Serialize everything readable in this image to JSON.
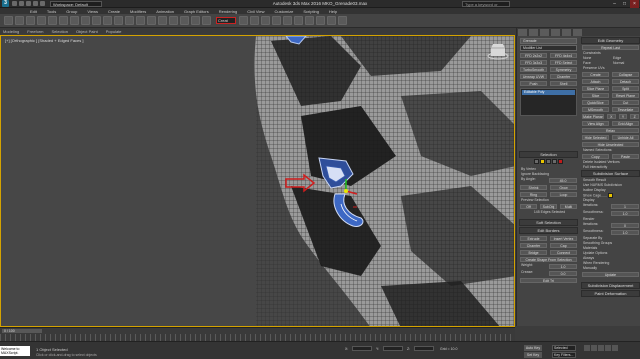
{
  "titlebar": {
    "workspace": "Workspace: Default",
    "title": "Autodesk 3ds Max 2016     MKO_Grenade03.max",
    "search_placeholder": "Type a keyword or phrase"
  },
  "menu": [
    "Edit",
    "Tools",
    "Group",
    "Views",
    "Create",
    "Modifiers",
    "Animation",
    "Graph Editors",
    "Rendering",
    "Civil View",
    "Customize",
    "Scripting",
    "Help"
  ],
  "toolbar": {
    "selection_set": "Creat"
  },
  "ribbon": [
    "Modeling",
    "Freeform",
    "Selection",
    "Object Paint",
    "Populate"
  ],
  "viewport": {
    "label": "[+] [Orthographic ] [Shaded + Edged Faces ]"
  },
  "panel": {
    "left": {
      "object_name": "Grenade",
      "modifier_list": "Modifier List",
      "buttons": [
        [
          "FFD 2x2x2",
          "FFD 4x4x4"
        ],
        [
          "FFD 3x3x3",
          "FFD Select"
        ],
        [
          "TurboSmooth",
          "Symmetry"
        ],
        [
          "Unwrap UVW",
          "Chamfer"
        ],
        [
          "Push",
          "Shell"
        ]
      ],
      "stack_item": "Editable Poly",
      "selection": {
        "title": "Selection",
        "by_vertex": "By Vertex",
        "ignore_backfacing": "Ignore Backfacing",
        "by_angle": "By Angle:",
        "angle_val": "45.0",
        "shrink": "Shrink",
        "grow": "Grow",
        "ring": "Ring",
        "loop": "Loop",
        "preview": "Preview Selection",
        "off": "Off",
        "subobj": "SubObj",
        "multi": "Multi",
        "status": "145 Edges Selected"
      },
      "soft": {
        "title": "Soft Selection",
        "edit_title": "Edit Borders",
        "extrude": "Extrude",
        "insert_vertex": "Insert Vertex",
        "chamfer": "Chamfer",
        "cap": "Cap",
        "bridge": "Bridge",
        "connect": "Connect",
        "create_shape": "Create Shape From Selection",
        "weight": "Weight:",
        "weight_val": "1.0",
        "crease": "Crease:",
        "crease_val": "0.0",
        "edit_tri": "Edit Tri"
      }
    },
    "right": {
      "edit_geometry": "Edit Geometry",
      "repeat_last": "Repeat Last",
      "constraints": "Constraints",
      "c_none": "None",
      "c_edge": "Edge",
      "c_face": "Face",
      "c_normal": "Normal",
      "preserve_uvs": "Preserve UVs",
      "create": "Create",
      "collapse": "Collapse",
      "attach": "Attach",
      "detach": "Detach",
      "slice_plane": "Slice Plane",
      "split": "Split",
      "slice": "Slice",
      "reset_plane": "Reset Plane",
      "quickslice": "QuickSlice",
      "cut": "Cut",
      "msmooth": "MSmooth",
      "tessellate": "Tessellate",
      "make_planar": "Make Planar",
      "x": "X",
      "y": "Y",
      "z": "Z",
      "view_align": "View Align",
      "grid_align": "Grid Align",
      "relax": "Relax",
      "hide_selected": "Hide Selected",
      "unhide_all": "Unhide All",
      "hide_unselected": "Hide Unselected",
      "named_selections": "Named Selections:",
      "copy": "Copy",
      "paste": "Paste",
      "delete_isolated": "Delete Isolated Vertices",
      "full_interactivity": "Full Interactivity",
      "subdiv_surface": "Subdivision Surface",
      "smooth_result": "Smooth Result",
      "use_nurms": "Use NURMS Subdivision",
      "isoline": "Isoline Display",
      "show_cage": "Show Cage......",
      "display": "Display",
      "iterations": "Iterations:",
      "iter_val": "1",
      "smoothness": "Smoothness:",
      "smooth_val": "1.0",
      "render": "Render",
      "r_iterations": "Iterations:",
      "r_iter_val": "0",
      "r_smoothness": "Smoothness:",
      "r_smooth_val": "1.0",
      "separate_by": "Separate By",
      "smoothing_groups": "Smoothing Groups",
      "materials": "Materials",
      "update_options": "Update Options",
      "always": "Always",
      "when_rendering": "When Rendering",
      "manually": "Manually",
      "update": "Update",
      "subdiv_disp": "Subdivision Displacement",
      "paint_deform": "Paint Deformation"
    },
    "swatch_colors": [
      "#e8c400",
      "#c11b1b"
    ]
  },
  "timeline": {
    "frame": "0 / 100",
    "ticks": [
      "0",
      "5",
      "10",
      "15",
      "20",
      "25",
      "30",
      "35",
      "40",
      "45",
      "50",
      "55",
      "60",
      "65",
      "70",
      "75",
      "80",
      "85",
      "90",
      "95",
      "100"
    ]
  },
  "status": {
    "maxscript": "Welcome to MAXScript.",
    "objects": "1 Object Selected",
    "prompt": "Click or click-and-drag to select objects",
    "x_label": "X:",
    "y_label": "Y:",
    "z_label": "Z:",
    "grid": "Grid = 10.0",
    "auto_key": "Auto Key",
    "selected": "Selected",
    "set_key": "Set Key",
    "key_filters": "Key Filters..."
  }
}
